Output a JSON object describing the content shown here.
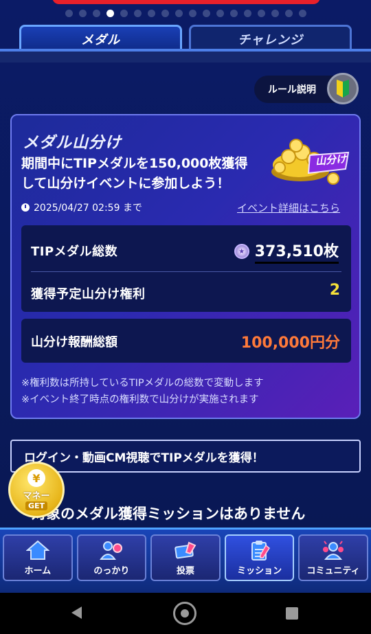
{
  "pager": {
    "count": 18,
    "active_index": 3
  },
  "tabs": [
    {
      "label": "メダル",
      "active": true
    },
    {
      "label": "チャレンジ",
      "active": false
    }
  ],
  "rules": {
    "label": "ルール説明",
    "icon": "beginner-leaf-icon"
  },
  "card": {
    "title": "メダル山分け",
    "description": "期間中にTIPメダルを150,000枚獲得して山分けイベントに参加しよう！",
    "image_label": "山分け",
    "deadline": "2025/04/27 02:59 まで",
    "detail_link": "イベント詳細はこちら",
    "medal_total_label": "TIPメダル総数",
    "medal_total_value": "373,510枚",
    "entitlement_label": "獲得予定山分け権利",
    "entitlement_value": "2",
    "reward_label": "山分け報酬総額",
    "reward_value": "100,000円分",
    "notes": [
      "※権利数は所持しているTIPメダルの総数で変動します",
      "※イベント終了時点の権利数で山分けが実施されます"
    ]
  },
  "get_banner": "ログイン・動画CM視聴でTIPメダルを獲得！",
  "empty_message": "対象のメダル獲得ミッションはありません",
  "money_button": {
    "coin": "¥",
    "label": "マネー",
    "get": "GET"
  },
  "nav": [
    {
      "label": "ホーム",
      "icon": "home-icon",
      "active": false
    },
    {
      "label": "のっかり",
      "icon": "people-icon",
      "active": false
    },
    {
      "label": "投票",
      "icon": "vote-ticket-icon",
      "active": false
    },
    {
      "label": "ミッション",
      "icon": "clipboard-icon",
      "active": true
    },
    {
      "label": "コミュニティ",
      "icon": "community-icon",
      "active": false
    }
  ],
  "colors": {
    "background": "#0a1a5c",
    "accent_yellow": "#f5e03a",
    "accent_orange": "#ff7a3a",
    "tab_border": "#6aa6ff"
  }
}
